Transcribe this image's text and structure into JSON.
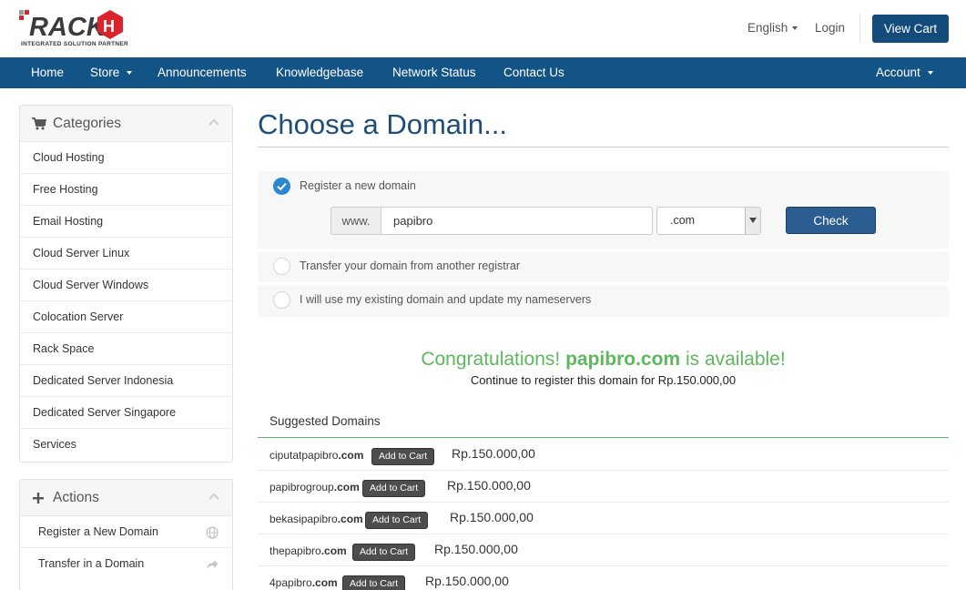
{
  "header": {
    "logo_tagline": "INTEGRATED SOLUTION PARTNER",
    "language_label": "English",
    "login_label": "Login",
    "view_cart_label": "View Cart"
  },
  "nav": {
    "items": [
      {
        "label": "Home"
      },
      {
        "label": "Store"
      },
      {
        "label": "Announcements"
      },
      {
        "label": "Knowledgebase"
      },
      {
        "label": "Network Status"
      },
      {
        "label": "Contact Us"
      }
    ],
    "account_label": "Account"
  },
  "sidebar": {
    "categories": {
      "title": "Categories",
      "items": [
        {
          "label": "Cloud Hosting"
        },
        {
          "label": "Free Hosting"
        },
        {
          "label": "Email Hosting"
        },
        {
          "label": "Cloud Server Linux"
        },
        {
          "label": "Cloud Server Windows"
        },
        {
          "label": "Colocation Server"
        },
        {
          "label": "Rack Space"
        },
        {
          "label": "Dedicated Server Indonesia"
        },
        {
          "label": "Dedicated Server Singapore"
        },
        {
          "label": "Services"
        }
      ]
    },
    "actions": {
      "title": "Actions",
      "items": [
        {
          "label": "Register a New Domain",
          "icon": "globe-icon"
        },
        {
          "label": "Transfer in a Domain",
          "icon": "share-arrow-icon"
        }
      ]
    }
  },
  "main": {
    "title": "Choose a Domain...",
    "options": {
      "register_label": "Register a new domain",
      "transfer_label": "Transfer your domain from another registrar",
      "existing_label": "I will use my existing domain and update my nameservers",
      "selected": "register"
    },
    "search": {
      "www_prefix": "www.",
      "domain_value": "papibro",
      "tld_value": ".com",
      "check_label": "Check"
    },
    "result": {
      "congrats_prefix": "Congratulations!",
      "domain": "papibro.com",
      "congrats_suffix": "is available!",
      "continue_text": "Continue to register this domain for Rp.150.000,00"
    },
    "suggested": {
      "title": "Suggested Domains",
      "add_to_cart_label": "Add to Cart",
      "rows": [
        {
          "name": "ciputatpapibro",
          "tld": ".com",
          "price": "Rp.150.000,00"
        },
        {
          "name": "papibrogroup",
          "tld": ".com",
          "price": "Rp.150.000,00"
        },
        {
          "name": "bekasipapibro",
          "tld": ".com",
          "price": "Rp.150.000,00"
        },
        {
          "name": "thepapibro",
          "tld": ".com",
          "price": "Rp.150.000,00"
        },
        {
          "name": "4papibro",
          "tld": ".com",
          "price": "Rp.150.000,00"
        }
      ]
    }
  },
  "colors": {
    "brand_blue": "#135487",
    "title_blue": "#1d4e79",
    "success_green": "#5cb85c",
    "logo_red": "#d9242b"
  }
}
